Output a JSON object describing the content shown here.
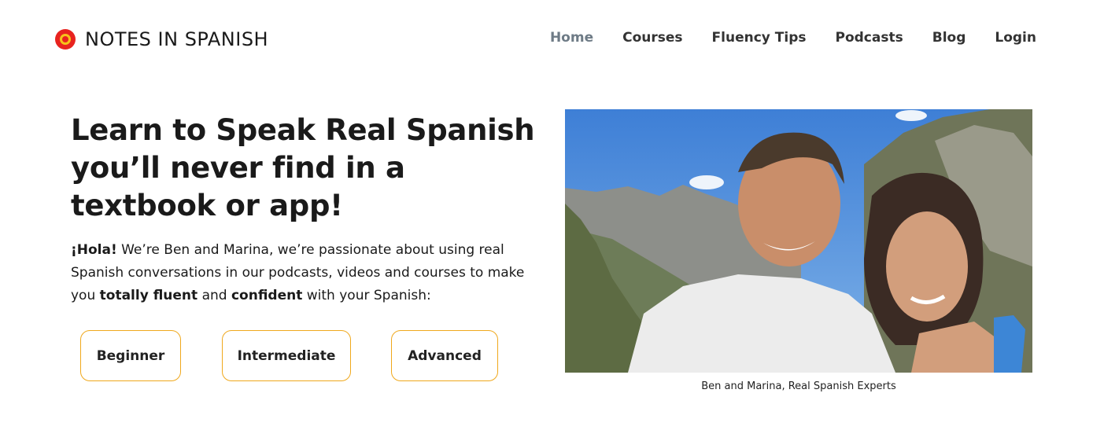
{
  "brand": {
    "name": "NOTES IN SPANISH",
    "logo_icon": "circle-logo-icon",
    "logo_colors": [
      "#e8231f",
      "#f6c21a"
    ]
  },
  "nav": {
    "items": [
      {
        "label": "Home",
        "active": true
      },
      {
        "label": "Courses",
        "active": false
      },
      {
        "label": "Fluency Tips",
        "active": false
      },
      {
        "label": "Podcasts",
        "active": false
      },
      {
        "label": "Blog",
        "active": false
      },
      {
        "label": "Login",
        "active": false
      }
    ]
  },
  "hero": {
    "title": "Learn to Speak Real Spanish you’ll never find in a textbook or app!",
    "intro": {
      "greeting": "¡Hola!",
      "text_1": " We’re Ben and Marina, we’re passionate about using real Spanish conversations in our podcasts, videos and courses to make you ",
      "emph_1": "totally fluent",
      "text_2": " and ",
      "emph_2": "confident",
      "text_3": " with your Spanish:"
    },
    "levels": [
      {
        "label": "Beginner"
      },
      {
        "label": "Intermediate"
      },
      {
        "label": "Advanced"
      }
    ]
  },
  "photo": {
    "caption": "Ben and Marina, Real Spanish Experts"
  },
  "colors": {
    "accent_border": "#f0a81c",
    "nav_active": "#6e7b86",
    "text": "#1a1a1a"
  }
}
